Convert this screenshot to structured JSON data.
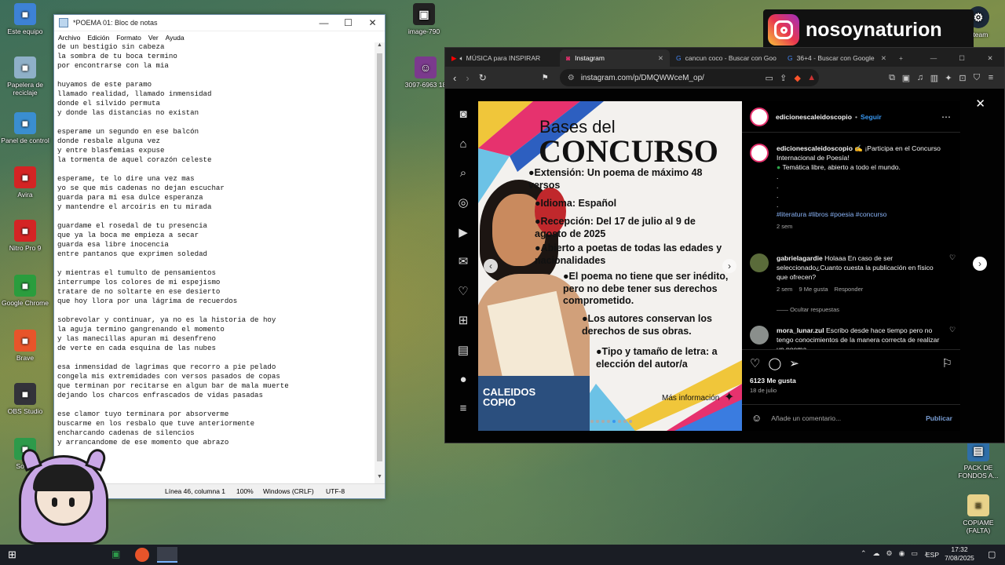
{
  "desktop": {
    "left_icons": [
      {
        "label": "Este equipo",
        "icon": "pc-icon",
        "color": "#3d82d6"
      },
      {
        "label": "Papelera de reciclaje",
        "icon": "recycle-bin-icon",
        "color": "#8fb0c8"
      },
      {
        "label": "Panel de control",
        "icon": "control-panel-icon",
        "color": "#3a8ed0"
      },
      {
        "label": "Avira",
        "icon": "avira-icon",
        "color": "#d42424"
      },
      {
        "label": "Nitro Pro 9",
        "icon": "nitro-icon",
        "color": "#d42424"
      },
      {
        "label": "Google Chrome",
        "icon": "chrome-icon",
        "color": "#2a9d3d"
      },
      {
        "label": "Brave",
        "icon": "brave-icon",
        "color": "#e8542a"
      },
      {
        "label": "OBS Studio",
        "icon": "obs-icon",
        "color": "#33333a"
      },
      {
        "label": "Social",
        "icon": "folder-icon",
        "color": "#2d9a4a"
      }
    ],
    "middle_icons": [
      {
        "label": "image-790",
        "icon": "image-file-icon"
      },
      {
        "label": "3097-6963 18",
        "icon": "image-file-icon"
      }
    ],
    "right_icons": [
      {
        "label": "Steam",
        "icon": "steam-icon"
      },
      {
        "label": "PACK DE FONDOS A...",
        "icon": "folder-icon"
      },
      {
        "label": "COPIAME (FALTA)",
        "icon": "text-file-icon"
      }
    ],
    "overlay_handle": "nosoynaturion"
  },
  "notepad": {
    "title": "*POEMA 01: Bloc de notas",
    "menu": [
      "Archivo",
      "Edición",
      "Formato",
      "Ver",
      "Ayuda"
    ],
    "lines": [
      "de un bestigio sin cabeza",
      "la sombra de tu boca termino",
      "por encontrarse con la mia",
      "",
      "huyamos de este paramo",
      "llamado realidad, llamado inmensidad",
      "donde el silvido permuta",
      "y donde las distancias no existan",
      "",
      "esperame un segundo en ese balcón",
      "donde resbale alguna vez",
      "y entre blasfemias expuse",
      "la tormenta de aquel corazón celeste",
      "",
      "esperame, te lo dire una vez mas",
      "yo se que mis cadenas no dejan escuchar",
      "guarda para mi esa dulce esperanza",
      "y mantendre el arcoiris en tu mirada",
      "",
      "guardame el rosedal de tu presencia",
      "que ya la boca me empieza a secar",
      "guarda esa libre inocencia",
      "entre pantanos que exprimen soledad",
      "",
      "y mientras el tumulto de pensamientos",
      "interrumpe los colores de mi espejismo",
      "tratare de no soltarte en ese desierto",
      "que hoy llora por una lágrima de recuerdos",
      "",
      "sobrevolar y continuar, ya no es la historia de hoy",
      "la aguja termino gangrenando el momento",
      "y las manecillas apuran mi desenfreno",
      "de verte en cada esquina de las nubes",
      "",
      "esa inmensidad de lagrimas que recorro a pie pelado",
      "congela mis extremidades con versos pasados de copas",
      "que terminan por recitarse en algun bar de mala muerte",
      "dejando los charcos enfrascados de vidas pasadas",
      "",
      "ese clamor tuyo terminara por absorverme",
      "buscarme en los resbalo que tuve anteriormente",
      "encharcando cadenas de silencios",
      "y arrancandome de ese momento que abrazo"
    ],
    "status": {
      "position": "Línea 46, columna 1",
      "zoom": "100%",
      "eol": "Windows (CRLF)",
      "encoding": "UTF-8"
    }
  },
  "browser": {
    "tabs": [
      {
        "label": "MÚSICA para INSPIRAR",
        "icon": "youtube-icon",
        "active": false
      },
      {
        "label": "Instagram",
        "icon": "instagram-icon",
        "active": true
      },
      {
        "label": "cancun coco - Buscar con Goo",
        "icon": "google-icon",
        "active": false
      },
      {
        "label": "36+4 - Buscar con Google",
        "icon": "google-icon",
        "active": false
      }
    ],
    "url": "instagram.com/p/DMQWWceM_op/"
  },
  "post": {
    "heading_small": "Bases del",
    "heading_big": "CONCURSO",
    "bullets": [
      "●Extensión: Un poema de máximo 48 versos",
      "●Idioma: Español",
      "●Recepción: Del 17 de julio al 9 de agosto de 2025",
      "●Abierto a poetas de todas las edades y nacionalidades",
      "●El poema no tiene que ser inédito, pero no debe tener sus derechos comprometido.",
      "●Los autores conservan los derechos de sus obras.",
      "●Tipo y tamaño de letra: a elección del autor/a"
    ],
    "logo_line1": "CALEIDOS",
    "logo_line2": "COPIO",
    "more_info": "Más información"
  },
  "panel": {
    "account": "edicionescaleidoscopio",
    "follow": "Seguir",
    "caption_line1": "¡Participa en el Concurso Internacional de Poesía!",
    "caption_line2": "Temática libre, abierto a todo el mundo.",
    "hashtags": "#literatura #libros #poesia #concurso",
    "caption_time": "2 sem",
    "comment1_user": "gabrielagardie",
    "comment1_text": "Holaaa  En caso de ser seleccionado¿Cuanto cuesta la publicación en físico que ofrecen?",
    "comment1_meta": [
      "2 sem",
      "9 Me gusta",
      "Responder"
    ],
    "hide_replies": "Ocultar respuestas",
    "comment2_user": "mora_lunar.zul",
    "comment2_text": "Escribo desde hace tiempo pero no tengo conocimientos de la manera correcta de realizar un poema",
    "likes": "6123 Me gusta",
    "date": "18 de julio",
    "comment_placeholder": "Añade un comentario...",
    "publish": "Publicar"
  },
  "taskbar": {
    "lang": "ESP",
    "time": "17:32",
    "date": "7/08/2025"
  }
}
